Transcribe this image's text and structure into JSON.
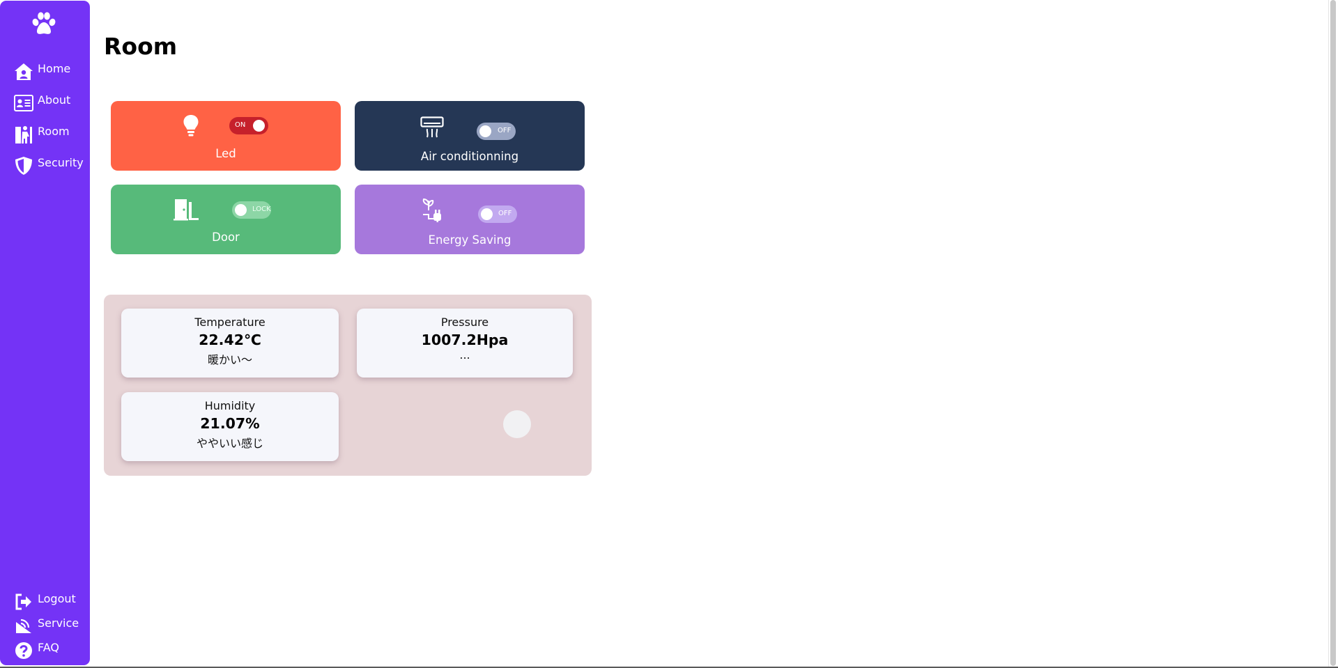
{
  "sidebar": {
    "logo_icon": "paw-icon",
    "items": [
      {
        "label": "Home",
        "icon": "home-icon"
      },
      {
        "label": "About",
        "icon": "id-card-icon"
      },
      {
        "label": "Room",
        "icon": "room-icon"
      },
      {
        "label": "Security",
        "icon": "shield-icon"
      }
    ],
    "bottom_items": [
      {
        "label": "Logout",
        "icon": "logout-icon"
      },
      {
        "label": "Service",
        "icon": "satellite-icon"
      },
      {
        "label": "FAQ",
        "icon": "question-icon"
      }
    ],
    "color": "#7433f6"
  },
  "page": {
    "title": "Room"
  },
  "devices": [
    {
      "label": "Led",
      "icon": "lightbulb-icon",
      "toggle": "ON",
      "state": true,
      "color": "#ff6245"
    },
    {
      "label": "Air conditionning",
      "icon": "air-conditioner-icon",
      "toggle": "OFF",
      "state": false,
      "color": "#253755"
    },
    {
      "label": "Door",
      "icon": "door-icon",
      "toggle": "LOCK",
      "state": false,
      "color": "#57ba7a"
    },
    {
      "label": "Energy Saving",
      "icon": "eco-plug-icon",
      "toggle": "OFF",
      "state": false,
      "color": "#a678dc"
    }
  ],
  "sensors": [
    {
      "name": "Temperature",
      "value": "22.42℃",
      "note": "暖かい〜"
    },
    {
      "name": "Pressure",
      "value": "1007.2Hpa",
      "note": "..."
    },
    {
      "name": "Humidity",
      "value": "21.07%",
      "note": "ややいい感じ"
    }
  ]
}
